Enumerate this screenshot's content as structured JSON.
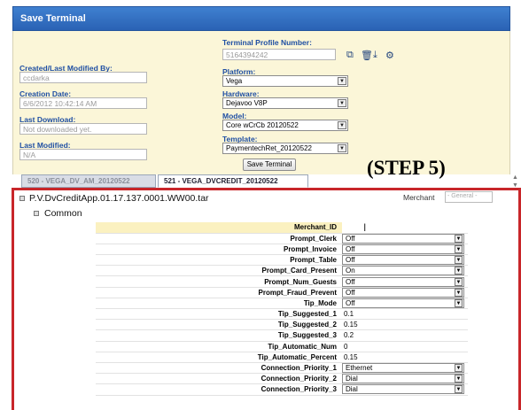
{
  "window": {
    "title": "Save Terminal"
  },
  "form": {
    "terminal_profile_label": "Terminal Profile Number:",
    "terminal_profile_value": "5164394242",
    "created_by_label": "Created/Last Modified By:",
    "created_by_value": "ccdarka",
    "creation_date_label": "Creation Date:",
    "creation_date_value": "6/6/2012 10:42:14 AM",
    "last_download_label": "Last Download:",
    "last_download_value": "Not downloaded yet.",
    "last_modified_label": "Last Modified:",
    "last_modified_value": "N/A",
    "platform_label": "Platform:",
    "platform_value": "Vega",
    "hardware_label": "Hardware:",
    "hardware_value": "Dejavoo V8P",
    "model_label": "Model:",
    "model_value": "Core wCrCb 20120522",
    "template_label": "Template:",
    "template_value": "PaymentechRet_20120522",
    "save_button": "Save Terminal"
  },
  "tabs": [
    {
      "label": "520 - VEGA_DV_AM_20120522"
    },
    {
      "label": "521 - VEGA_DVCREDIT_20120522"
    }
  ],
  "step_label": "(STEP 5)",
  "package": {
    "name": "P.V.DvCreditApp.01.17.137.0001.WW00.tar",
    "merchant_label": "Merchant",
    "merchant_value": "- General -"
  },
  "group": {
    "name": "Common"
  },
  "params": [
    {
      "name": "Merchant_ID",
      "value": "",
      "type": "text"
    },
    {
      "name": "Prompt_Clerk",
      "value": "Off",
      "type": "select"
    },
    {
      "name": "Prompt_Invoice",
      "value": "Off",
      "type": "select"
    },
    {
      "name": "Prompt_Table",
      "value": "Off",
      "type": "select"
    },
    {
      "name": "Prompt_Card_Present",
      "value": "On",
      "type": "select"
    },
    {
      "name": "Prompt_Num_Guests",
      "value": "Off",
      "type": "select"
    },
    {
      "name": "Prompt_Fraud_Prevent",
      "value": "Off",
      "type": "select"
    },
    {
      "name": "Tip_Mode",
      "value": "Off",
      "type": "select"
    },
    {
      "name": "Tip_Suggested_1",
      "value": "0.1",
      "type": "text"
    },
    {
      "name": "Tip_Suggested_2",
      "value": "0.15",
      "type": "text"
    },
    {
      "name": "Tip_Suggested_3",
      "value": "0.2",
      "type": "text"
    },
    {
      "name": "Tip_Automatic_Num",
      "value": "0",
      "type": "text"
    },
    {
      "name": "Tip_Automatic_Percent",
      "value": "0.15",
      "type": "text"
    },
    {
      "name": "Connection_Priority_1",
      "value": "Ethernet",
      "type": "select"
    },
    {
      "name": "Connection_Priority_2",
      "value": "Dial",
      "type": "select"
    },
    {
      "name": "Connection_Priority_3",
      "value": "Dial",
      "type": "select"
    }
  ]
}
